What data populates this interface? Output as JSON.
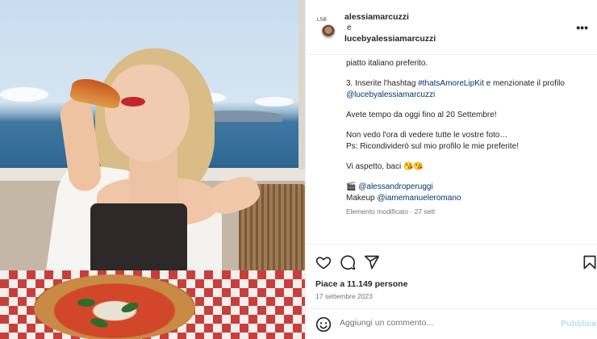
{
  "post": {
    "author": "alessiamarcuzzi",
    "avatar_badge": "LSB",
    "conjunction": "e",
    "collaborator": "lucebyalessiamarcuzzi"
  },
  "caption": {
    "line_top": "piatto italiano preferito.",
    "step3_prefix": "3. Inserite l'hashtag ",
    "step3_hashtag": "#thatsAmoreLipKit",
    "step3_suffix": " e menzionate il profilo",
    "step3_mention": "@lucebyalessiamarcuzzi",
    "deadline": "Avete tempo da oggi fino al 20 Settembre!",
    "line_wait": "Non vedo l'ora di vedere tutte le vostre foto…",
    "line_ps": "Ps: Ricondividerò sul mio profilo le mie preferite!",
    "goodbye": "Vi aspetto, baci 😘😘",
    "credit_photo_icon": "🎬",
    "credit_photo": "@alessandroperuggi",
    "credit_makeup_label": "Makeup ",
    "credit_makeup": "@iamemanueleromano",
    "edited_meta": "Elemento modificato · 27 sett"
  },
  "actions": {
    "icons": [
      "heart-icon",
      "comment-icon",
      "share-icon",
      "bookmark-icon"
    ],
    "likes": "Piace a 11.149 persone",
    "date": "17 settembre 2023"
  },
  "comment": {
    "placeholder": "Aggiungi un commento...",
    "publish_label": "Pubblica"
  },
  "colors": {
    "link": "#00376b",
    "publish": "#b2dffc",
    "muted": "#737373"
  }
}
